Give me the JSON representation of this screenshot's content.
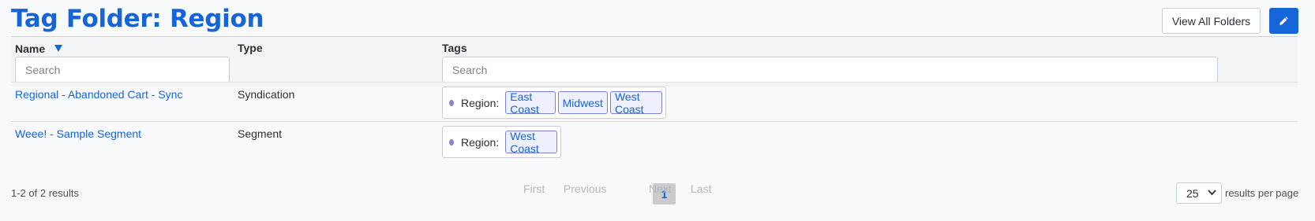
{
  "header": {
    "title": "Tag Folder: Region",
    "view_all_label": "View All Folders",
    "edit_icon": "pencil-icon"
  },
  "table": {
    "columns": {
      "name": "Name",
      "type": "Type",
      "tags": "Tags"
    },
    "sort_icon": "sort-down-icon",
    "name_search_placeholder": "Search",
    "tags_search_placeholder": "Search",
    "rows": [
      {
        "name": "Regional - Abandoned Cart - Sync",
        "type": "Syndication",
        "tag_category": "Region:",
        "tags": [
          "East Coast",
          "Midwest",
          "West Coast"
        ]
      },
      {
        "name": "Weee! - Sample Segment",
        "type": "Segment",
        "tag_category": "Region:",
        "tags": [
          "West Coast"
        ]
      }
    ]
  },
  "footer": {
    "result_count": "1-2 of 2 results",
    "pager": {
      "first": "First",
      "previous": "Previous",
      "current": "1",
      "next": "Next",
      "last": "Last"
    },
    "per_page_value": "25",
    "per_page_label": "results per page"
  },
  "colors": {
    "accent": "#1565d8",
    "tag_dot": "#8c82d8",
    "chip_border": "#7a83d8"
  }
}
